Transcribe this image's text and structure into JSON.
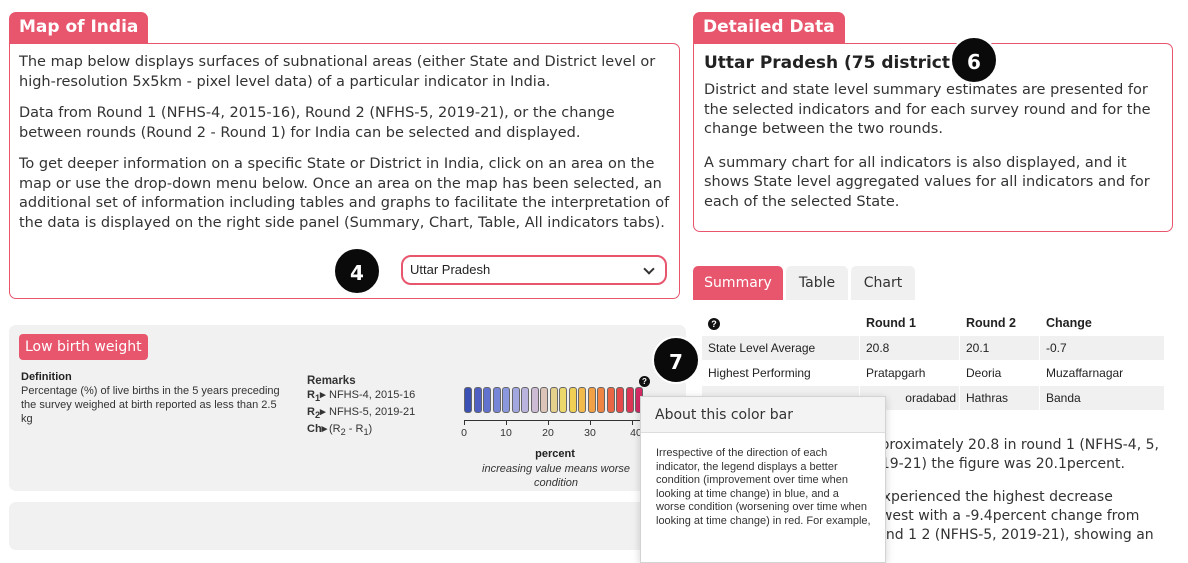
{
  "map_section": {
    "title": "Map of India",
    "paragraphs": [
      "The map below displays surfaces of subnational areas (either State and District level or high-resolution 5x5km - pixel level data) of a particular indicator in India.",
      "Data from Round 1 (NFHS-4, 2015-16), Round 2 (NFHS-5, 2019-21), or the change between rounds (Round 2 - Round 1) for India can be selected and displayed.",
      "To get deeper information on a specific State or District in India, click on an area on the map or use the drop-down menu below. Once an area on the map has been selected, an additional set of information including tables and graphs to facilitate the interpretation of the data is displayed on the right side panel (Summary, Chart, Table, All indicators tabs)."
    ],
    "dropdown_value": "Uttar Pradesh"
  },
  "badges": {
    "b4": "4",
    "b6": "6",
    "b7": "7"
  },
  "detail_section": {
    "title": "Detailed Data",
    "heading": "Uttar Pradesh (75 districts)",
    "paragraphs": [
      "District and state level summary estimates are presented for the selected indicators and for each survey round and for the change between the two rounds.",
      "A summary chart for all indicators is also displayed, and it shows State level aggregated values for all indicators and for each of the selected State."
    ]
  },
  "tabs": [
    "Summary",
    "Table",
    "Chart"
  ],
  "summary_table": {
    "headers": [
      "?",
      "Round 1",
      "Round 2",
      "Change"
    ],
    "rows": [
      [
        "State Level Average",
        "20.8",
        "20.1",
        "-0.7"
      ],
      [
        "Highest Performing",
        "Pratapgarh",
        "Deoria",
        "Muzaffarnagar"
      ],
      [
        "",
        "oradabad",
        "Hathras",
        "Banda"
      ]
    ]
  },
  "summary_text": {
    "p1": "approximately 20.8 in round 1 (NFHS-4, 5, 2019-21) the figure was 20.1percent.",
    "p2_bold": "r",
    "p2": " experienced the highest decrease (lowest with a -9.4percent change from round 1 2 (NFHS-5, 2019-21), showing an"
  },
  "indicator": {
    "label": "Low birth weight",
    "definition_title": "Definition",
    "definition": "Percentage (%) of live births in the 5 years preceding the survey weighed at birth reported as less than 2.5 kg",
    "remarks_title": "Remarks",
    "remarks": [
      {
        "key": "R1",
        "text": "NFHS-4, 2015-16"
      },
      {
        "key": "R2",
        "text": "NFHS-5, 2019-21"
      },
      {
        "key": "Ch",
        "text": "(R2 - R1)"
      }
    ],
    "scale_ticks": [
      "0",
      "10",
      "20",
      "30",
      "40"
    ],
    "unit": "percent",
    "note": "increasing value means worse condition",
    "colors": [
      "#3a50b4",
      "#4f5fc4",
      "#6272cf",
      "#7886d8",
      "#8c98dd",
      "#a3a7e0",
      "#b9b3de",
      "#cdbbd5",
      "#dcc4b8",
      "#e4d08a",
      "#ecd86a",
      "#f0cf55",
      "#f2b94b",
      "#f2a046",
      "#ef8443",
      "#ea6745",
      "#e4494b",
      "#db3656",
      "#d42a66"
    ]
  },
  "tooltip": {
    "title": "About this color bar",
    "body": "Irrespective of the direction of each indicator, the legend displays a better condition (improvement over time when looking at time change) in blue, and a worse condition (worsening over time when looking at time change) in red. For example,"
  }
}
